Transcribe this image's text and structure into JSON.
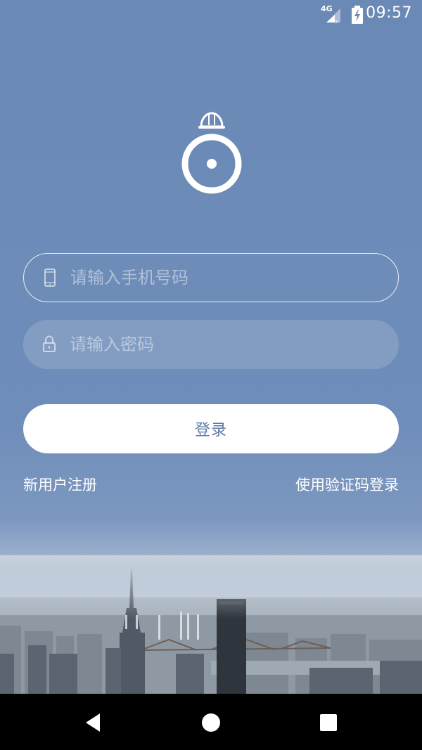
{
  "status_bar": {
    "network": "4G",
    "time": "09:57"
  },
  "login_form": {
    "phone_placeholder": "请输入手机号码",
    "password_placeholder": "请输入密码",
    "login_label": "登录"
  },
  "links": {
    "register": "新用户注册",
    "sms_login": "使用验证码登录"
  },
  "colors": {
    "background": "#6b8ab6",
    "button_text": "#5d7ba6",
    "button_bg": "#ffffff"
  },
  "icons": {
    "logo": "helmet-target-logo-icon",
    "phone": "phone-icon",
    "lock": "lock-icon"
  }
}
